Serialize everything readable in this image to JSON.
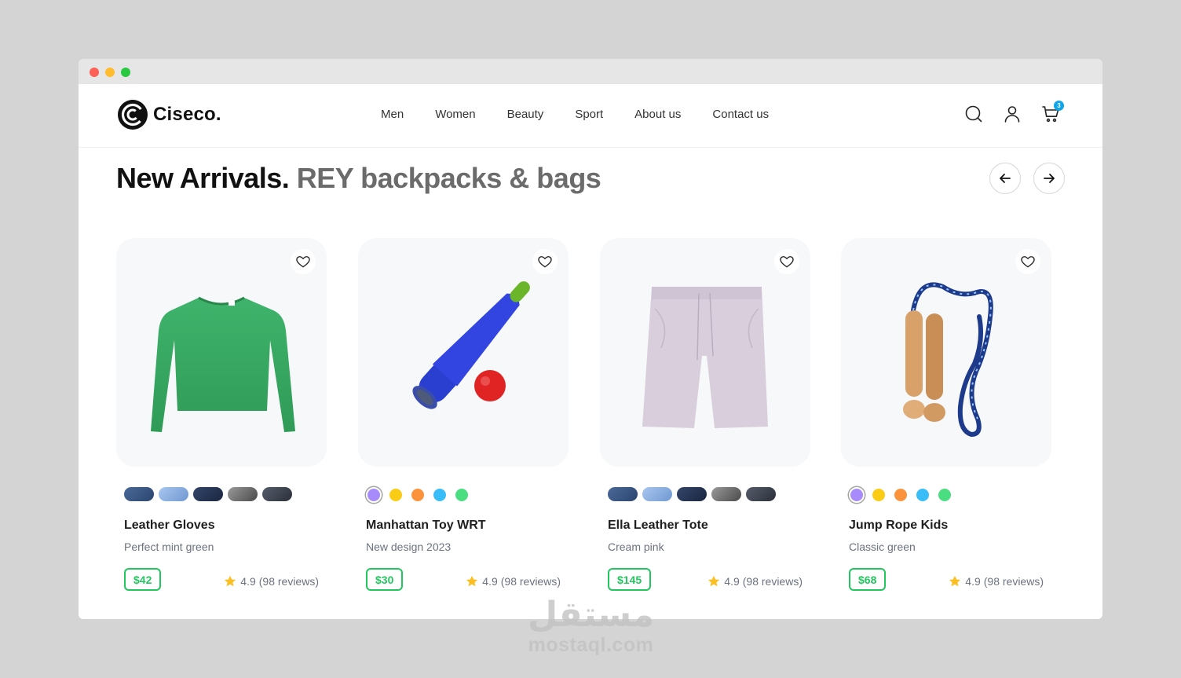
{
  "brand": {
    "name": "Ciseco."
  },
  "nav": {
    "items": [
      "Men",
      "Women",
      "Beauty",
      "Sport",
      "About us",
      "Contact us"
    ]
  },
  "cart": {
    "count": "3"
  },
  "section": {
    "title_bold": "New Arrivals.",
    "title_muted": "REY backpacks & bags"
  },
  "products": [
    {
      "name": "Leather Gloves",
      "desc": "Perfect mint green",
      "price": "$42",
      "rating": "4.9",
      "reviews": "(98 reviews)",
      "swatch_type": "image"
    },
    {
      "name": "Manhattan Toy WRT",
      "desc": "New design 2023",
      "price": "$30",
      "rating": "4.9",
      "reviews": "(98 reviews)",
      "swatch_type": "color"
    },
    {
      "name": "Ella Leather Tote",
      "desc": "Cream pink",
      "price": "$145",
      "rating": "4.9",
      "reviews": "(98 reviews)",
      "swatch_type": "image"
    },
    {
      "name": "Jump Rope Kids",
      "desc": "Classic green",
      "price": "$68",
      "rating": "4.9",
      "reviews": "(98 reviews)",
      "swatch_type": "color"
    }
  ],
  "swatch_colors": {
    "image": [
      "#34507a",
      "#8fb4e6",
      "#243452",
      "#7a7a7a",
      "#3d4350"
    ],
    "color": [
      "#a78bfa",
      "#facc15",
      "#fb923c",
      "#38bdf8",
      "#4ade80"
    ]
  },
  "colors": {
    "accent_green": "#22c55e",
    "badge_blue": "#0ea5e9",
    "star": "#fbbf24"
  },
  "watermark": {
    "arabic": "مستقل",
    "latin": "mostaql.com"
  }
}
